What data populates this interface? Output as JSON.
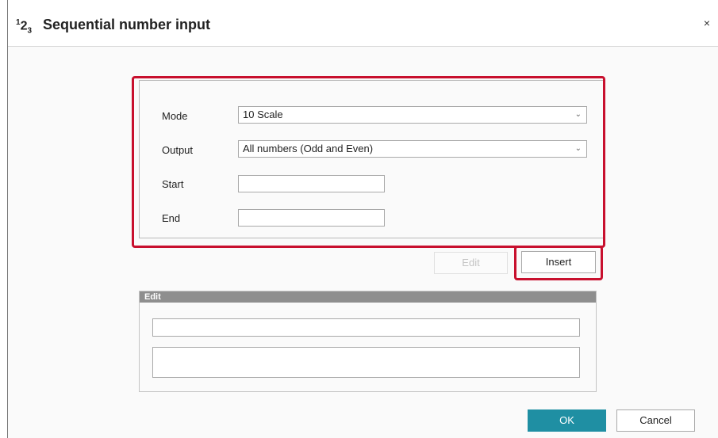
{
  "window": {
    "title": "Sequential number input",
    "icon_base": "1",
    "icon_mid": "2",
    "icon_sub": "3",
    "close_glyph": "×"
  },
  "params": {
    "mode_label": "Mode",
    "mode_value": "10 Scale",
    "output_label": "Output",
    "output_value": "All numbers (Odd and Even)",
    "start_label": "Start",
    "start_value": "",
    "end_label": "End",
    "end_value": ""
  },
  "actions": {
    "edit_label": "Edit",
    "insert_label": "Insert"
  },
  "edit_panel": {
    "header": "Edit",
    "field1_value": "",
    "field2_value": ""
  },
  "footer": {
    "ok_label": "OK",
    "cancel_label": "Cancel"
  },
  "colors": {
    "highlight": "#c8102e",
    "primary_button": "#1f8fa3",
    "panel_header": "#8e8e8e"
  },
  "icons": {
    "select_chevron": "chevron-down-icon",
    "close": "close-icon"
  }
}
